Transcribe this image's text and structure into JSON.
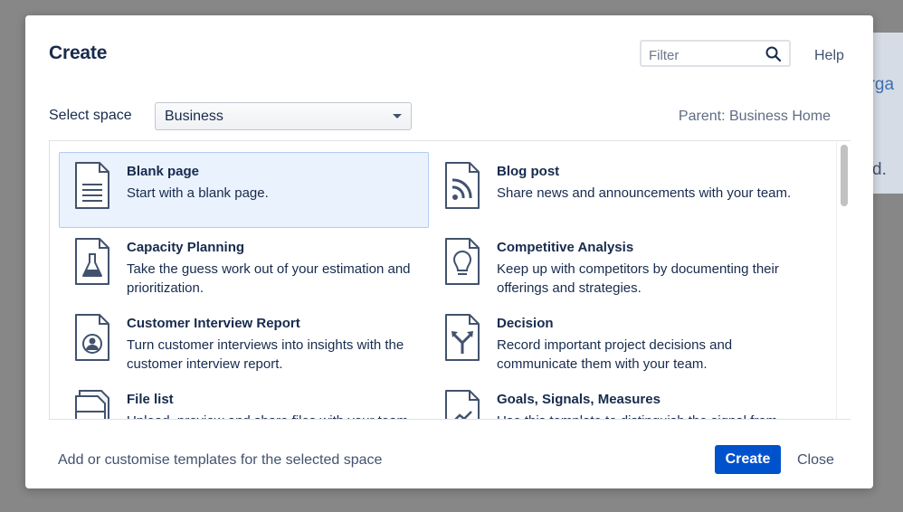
{
  "background": {
    "text_1": "orga",
    "text_2": "d."
  },
  "dialog": {
    "title": "Create",
    "filter_placeholder": "Filter",
    "help": "Help",
    "select_space_label": "Select space",
    "space_value": "Business",
    "parent_label": "Parent: Business Home"
  },
  "templates": [
    {
      "name": "Blank page",
      "desc": "Start with a blank page.",
      "icon": "blank-page-icon"
    },
    {
      "name": "Blog post",
      "desc": "Share news and announcements with your team.",
      "icon": "rss-icon"
    },
    {
      "name": "Capacity Planning",
      "desc": "Take the guess work out of your estimation and prioritization.",
      "icon": "flask-icon"
    },
    {
      "name": "Competitive Analysis",
      "desc": "Keep up with competitors by documenting their offerings and strategies.",
      "icon": "lightbulb-icon"
    },
    {
      "name": "Customer Interview Report",
      "desc": "Turn customer interviews into insights with the customer interview report.",
      "icon": "person-icon"
    },
    {
      "name": "Decision",
      "desc": "Record important project decisions and communicate them with your team.",
      "icon": "decision-arrows-icon"
    },
    {
      "name": "File list",
      "desc": "Upload, preview and share files with your team.",
      "icon": "file-list-icon"
    },
    {
      "name": "Goals, Signals, Measures",
      "desc": "Use this template to distinguish the signal from",
      "icon": "chart-icon"
    }
  ],
  "footer": {
    "customise_link": "Add or customise templates for the selected space",
    "create_label": "Create",
    "close_label": "Close"
  },
  "colors": {
    "primary": "#0052cc",
    "selected_bg": "#eaf2fd",
    "text": "#172b4d",
    "overlay": "#878787"
  }
}
